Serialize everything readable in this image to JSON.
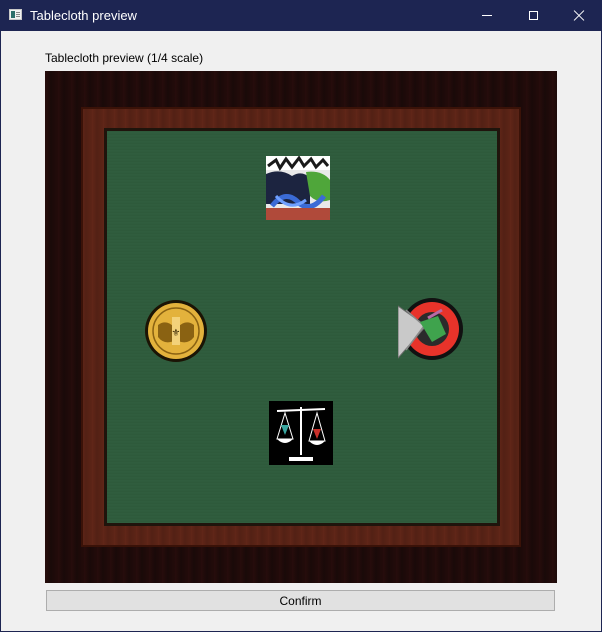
{
  "window": {
    "title": "Tablecloth preview",
    "controls": {
      "minimize": "minimize",
      "maximize": "maximize",
      "close": "close"
    }
  },
  "preview": {
    "label": "Tablecloth preview (1/4 scale)",
    "emblems": [
      {
        "position": "top",
        "icon": "graffiti-emblem"
      },
      {
        "position": "left",
        "icon": "gold-coin-emblem"
      },
      {
        "position": "right",
        "icon": "red-ring-emblem"
      },
      {
        "position": "bottom",
        "icon": "scales-emblem"
      }
    ],
    "colors": {
      "felt": "#2e5c3c",
      "frame": "#5a2518",
      "border": "#1e0b0a"
    }
  },
  "confirm_label": "Confirm"
}
